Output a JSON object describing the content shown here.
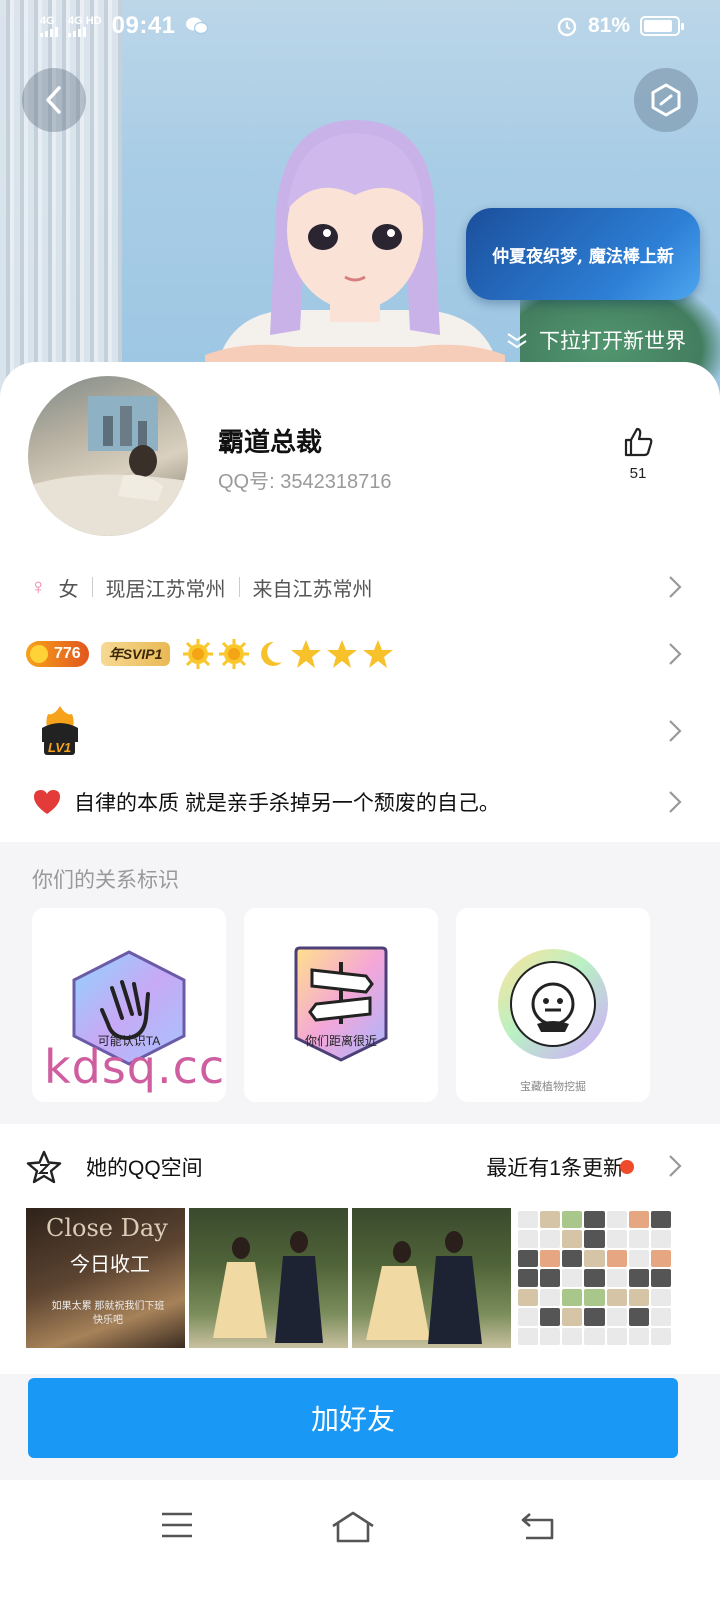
{
  "status_bar": {
    "signal1": "4G",
    "signal2": "4G HD",
    "time": "09:41",
    "battery": "81%"
  },
  "header": {
    "bubble_text": "仲夏夜织梦, 魔法棒上新",
    "pull_hint": "下拉打开新世界"
  },
  "profile": {
    "nickname": "霸道总裁",
    "qq_label": "QQ号: 3542318716",
    "like_count": "51",
    "gender_symbol": "♀",
    "gender": "女",
    "residence": "现居江苏常州",
    "hometown": "来自江苏常州",
    "level_badge": "776",
    "svip_badge": "年SVIP1",
    "lv_badge": "LV1",
    "signature": "自律的本质 就是亲手杀掉另一个颓废的自己。"
  },
  "relations": {
    "title": "你们的关系标识",
    "items": [
      {
        "label": "可能认识TA"
      },
      {
        "label": "你们距离很近"
      },
      {
        "label": "宝藏植物挖掘"
      }
    ]
  },
  "watermark": "kdsq.cc",
  "qzone": {
    "title": "她的QQ空间",
    "status": "最近有1条更新",
    "photo1_title": "Close Day",
    "photo1_sub": "今日收工",
    "photo1_line": "如果太累 那就祝我们下班快乐吧"
  },
  "actions": {
    "add_friend": "加好友"
  },
  "colors": {
    "accent": "#1a98f5",
    "update_dot": "#ee4b2b",
    "watermark": "#cf5ea0"
  }
}
